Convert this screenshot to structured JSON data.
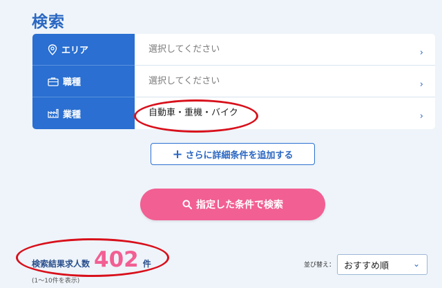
{
  "page": {
    "title": "検索"
  },
  "filters": [
    {
      "label": "エリア",
      "icon": "location-pin-icon",
      "value": "選択してください",
      "chevron": "›"
    },
    {
      "label": "職種",
      "icon": "briefcase-icon",
      "value": "選択してください",
      "chevron": "›"
    },
    {
      "label": "業種",
      "icon": "factory-icon",
      "value": "自動車・重機・バイク",
      "chevron": "›"
    }
  ],
  "actions": {
    "add_conditions_icon": "+",
    "add_conditions_label": "さらに詳細条件を追加する",
    "search_label": "指定した条件で検索"
  },
  "results": {
    "label": "検索結果求人数",
    "count": "402",
    "unit": "件",
    "range": "(1〜10件を表示)"
  },
  "sort": {
    "label": "並び替え：",
    "selected": "おすすめ順"
  },
  "colors": {
    "accent": "#2a6fd1",
    "pink": "#f25f93",
    "annotation": "#d8101b",
    "background": "#eef4fa"
  }
}
